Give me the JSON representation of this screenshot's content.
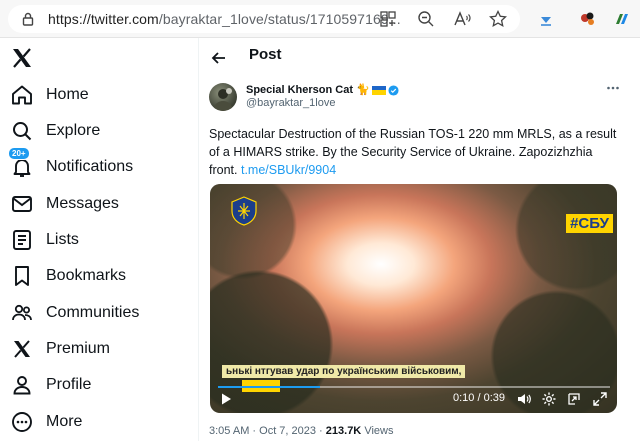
{
  "browser": {
    "url_host": "https://twitter.com",
    "url_path": "/bayraktar_1love/status/1710597169..."
  },
  "sidebar": {
    "items": [
      {
        "label": "Home",
        "icon": "home-icon"
      },
      {
        "label": "Explore",
        "icon": "search-icon"
      },
      {
        "label": "Notifications",
        "icon": "bell-icon",
        "badge": "20+"
      },
      {
        "label": "Messages",
        "icon": "mail-icon"
      },
      {
        "label": "Lists",
        "icon": "list-icon"
      },
      {
        "label": "Bookmarks",
        "icon": "bookmark-icon"
      },
      {
        "label": "Communities",
        "icon": "people-icon"
      },
      {
        "label": "Premium",
        "icon": "x-icon"
      },
      {
        "label": "Profile",
        "icon": "person-icon"
      },
      {
        "label": "More",
        "icon": "more-circle-icon"
      }
    ]
  },
  "post": {
    "header_title": "Post",
    "author_name": "Special Kherson Cat",
    "author_emoji": "🐈",
    "handle": "@bayraktar_1love",
    "text": "Spectacular Destruction of the Russian TOS-1 220 mm MRLS, as a result of a HIMARS strike. By the Security Service of Ukraine. Zapozizhzhia front. ",
    "link": "t.me/SBUkr/9904",
    "video": {
      "tag": "#СБУ",
      "subtitle": "ьнькі нтгував удар по українським військовим,",
      "current_time": "0:10",
      "duration": "0:39",
      "progress": 0.26
    },
    "timestamp": "3:05 AM · Oct 7, 2023 · ",
    "views_count": "213.7K",
    "views_label": " Views"
  },
  "colors": {
    "accent": "#1d9bf0",
    "text": "#0f1419",
    "muted": "#536471",
    "sbu_yellow": "#ffd400"
  }
}
